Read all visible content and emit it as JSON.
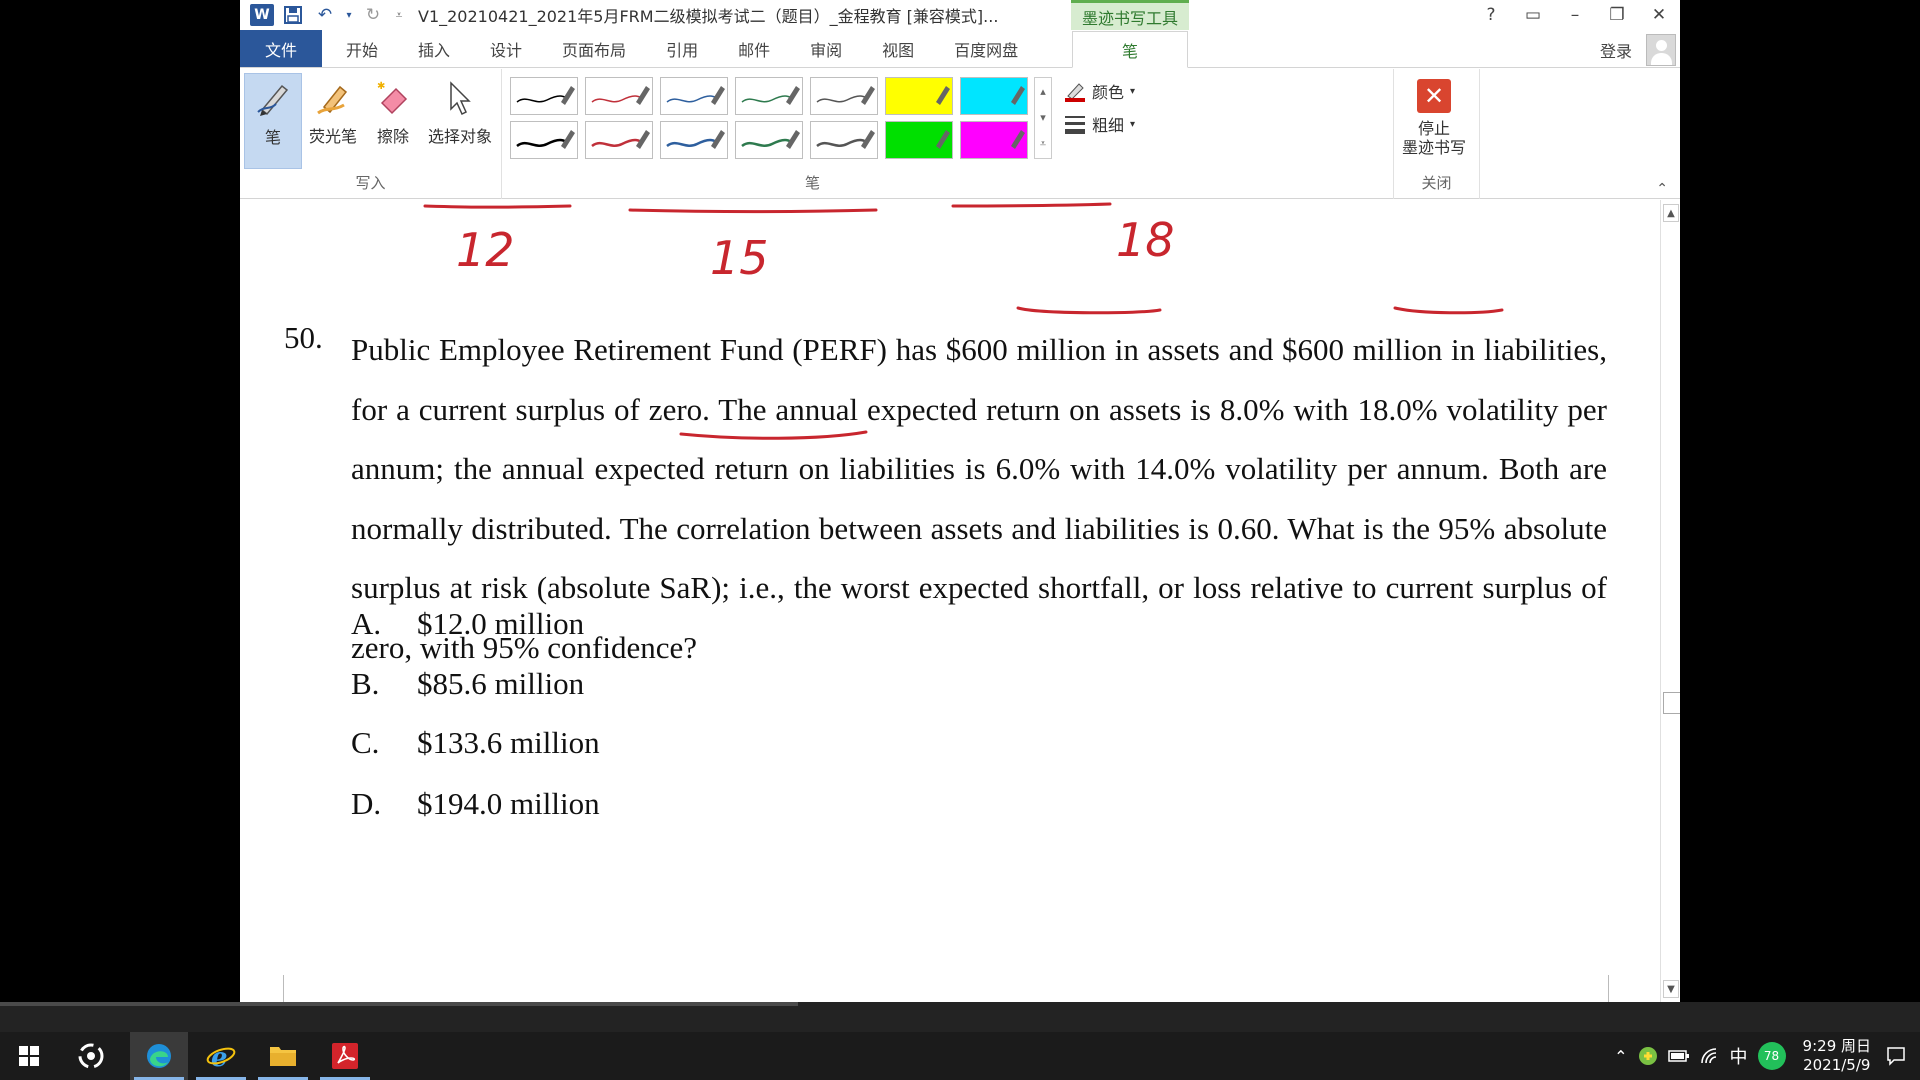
{
  "window": {
    "title": "V1_20210421_2021年5月FRM二级模拟考试二（题目）_金程教育 [兼容模式]...",
    "contextual_tab_group": "墨迹书写工具",
    "help": "?",
    "login": "登录"
  },
  "tabs": [
    {
      "label": "文件"
    },
    {
      "label": "开始"
    },
    {
      "label": "插入"
    },
    {
      "label": "设计"
    },
    {
      "label": "页面布局"
    },
    {
      "label": "引用"
    },
    {
      "label": "邮件"
    },
    {
      "label": "审阅"
    },
    {
      "label": "视图"
    },
    {
      "label": "百度网盘"
    },
    {
      "label": "笔"
    }
  ],
  "ribbon": {
    "write_group": {
      "label": "写入",
      "buttons": [
        {
          "label": "笔",
          "icon": "pen-icon",
          "selected": true
        },
        {
          "label": "荧光笔",
          "icon": "highlighter-icon"
        },
        {
          "label": "擦除",
          "icon": "eraser-icon"
        },
        {
          "label": "选择对象",
          "icon": "select-cursor-icon"
        }
      ]
    },
    "pens_group": {
      "label": "笔",
      "swatch_colors": [
        "#000000",
        "#c0303a",
        "#2e5f9e",
        "#2e7a4e",
        "#555555",
        "#ffff00",
        "#00e5ff",
        "#000000",
        "#c0303a",
        "#2e5f9e",
        "#2e7a4e",
        "#555555",
        "#00e000",
        "#ff00ff"
      ],
      "color_label": "颜色",
      "thickness_label": "粗细"
    },
    "close_group": {
      "label": "关闭",
      "stop_line1": "停止",
      "stop_line2": "墨迹书写"
    }
  },
  "document": {
    "handwritten": [
      "12",
      "15",
      "18"
    ],
    "question_number": "50.",
    "question_text": "Public Employee Retirement Fund (PERF) has $600 million in assets and $600 million in liabilities, for a current surplus of zero. The annual expected return on assets is 8.0% with 18.0% volatility per annum; the annual expected return on liabilities is 6.0% with 14.0% volatility per annum. Both are normally distributed. The correlation between assets and liabilities is 0.60. What is the 95% absolute surplus at risk (absolute SaR); i.e., the worst expected shortfall, or loss relative to current surplus of zero, with 95% confidence?",
    "choices": [
      {
        "letter": "A.",
        "text": "$12.0 million"
      },
      {
        "letter": "B.",
        "text": "$85.6 million"
      },
      {
        "letter": "C.",
        "text": "$133.6 million"
      },
      {
        "letter": "D.",
        "text": "$194.0 million"
      }
    ],
    "ink_color": "#c8262e"
  },
  "taskbar": {
    "apps": [
      {
        "icon": "windows-start-icon"
      },
      {
        "icon": "app-swirl-icon"
      },
      {
        "icon": "edge-browser-icon"
      },
      {
        "icon": "ie-browser-icon"
      },
      {
        "icon": "file-explorer-icon"
      },
      {
        "icon": "acrobat-icon"
      }
    ],
    "ime": "中",
    "badge": "78",
    "time": "9:29 周日",
    "date": "2021/5/9"
  }
}
